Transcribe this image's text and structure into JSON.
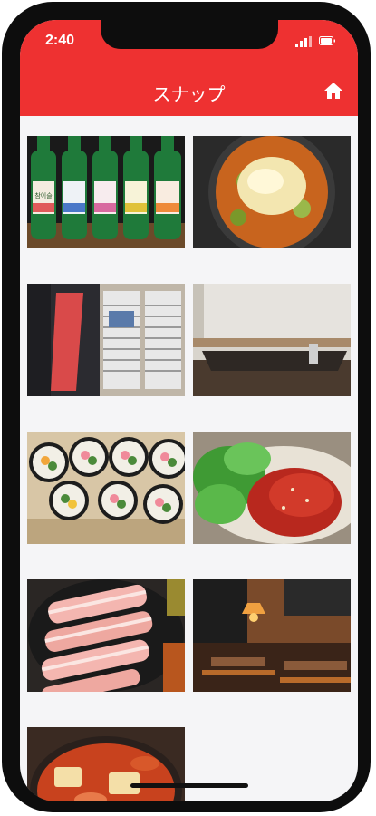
{
  "status_bar": {
    "time": "2:40"
  },
  "header": {
    "title": "スナップ",
    "home_icon": "home-icon"
  },
  "bottle_label": "참이슬",
  "colors": {
    "accent": "#ee3131",
    "background": "#f5f5f7"
  },
  "gallery": [
    {
      "subject": "soju-bottles"
    },
    {
      "subject": "cheese-stew"
    },
    {
      "subject": "shop-entrance"
    },
    {
      "subject": "empty-room"
    },
    {
      "subject": "kimbap"
    },
    {
      "subject": "spicy-salad"
    },
    {
      "subject": "pork-belly"
    },
    {
      "subject": "restaurant-interior"
    },
    {
      "subject": "kimchi-stew"
    }
  ]
}
